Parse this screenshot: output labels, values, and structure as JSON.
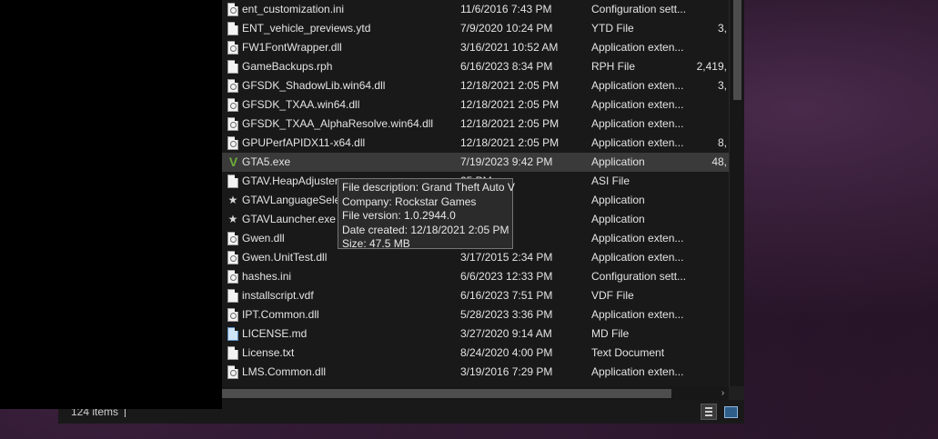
{
  "files": [
    {
      "name": "ent_customization.ini",
      "date": "11/6/2016 7:43 PM",
      "type": "Configuration sett...",
      "size": "",
      "icon": "settings-file-icon"
    },
    {
      "name": "ENT_vehicle_previews.ytd",
      "date": "7/9/2020 10:24 PM",
      "type": "YTD File",
      "size": "3,",
      "icon": "file-icon"
    },
    {
      "name": "FW1FontWrapper.dll",
      "date": "3/16/2021 10:52 AM",
      "type": "Application exten...",
      "size": "",
      "icon": "dll-file-icon"
    },
    {
      "name": "GameBackups.rph",
      "date": "6/16/2023 8:34 PM",
      "type": "RPH File",
      "size": "2,419,",
      "icon": "file-icon"
    },
    {
      "name": "GFSDK_ShadowLib.win64.dll",
      "date": "12/18/2021 2:05 PM",
      "type": "Application exten...",
      "size": "3,",
      "icon": "dll-file-icon"
    },
    {
      "name": "GFSDK_TXAA.win64.dll",
      "date": "12/18/2021 2:05 PM",
      "type": "Application exten...",
      "size": "",
      "icon": "dll-file-icon"
    },
    {
      "name": "GFSDK_TXAA_AlphaResolve.win64.dll",
      "date": "12/18/2021 2:05 PM",
      "type": "Application exten...",
      "size": "",
      "icon": "dll-file-icon"
    },
    {
      "name": "GPUPerfAPIDX11-x64.dll",
      "date": "12/18/2021 2:05 PM",
      "type": "Application exten...",
      "size": "8,",
      "icon": "dll-file-icon"
    },
    {
      "name": "GTA5.exe",
      "date": "7/19/2023 9:42 PM",
      "type": "Application",
      "size": "48,",
      "icon": "gta-v-icon",
      "hovered": true
    },
    {
      "name": "GTAV.HeapAdjuster.",
      "date": "25 PM",
      "type": "ASI File",
      "size": "",
      "icon": "file-icon"
    },
    {
      "name": "GTAVLanguageSelec",
      "date": "28 PM",
      "type": "Application",
      "size": "",
      "icon": "rockstar-icon"
    },
    {
      "name": "GTAVLauncher.exe",
      "date": "36 PM",
      "type": "Application",
      "size": "",
      "icon": "rockstar-icon"
    },
    {
      "name": "Gwen.dll",
      "date": "34 PM",
      "type": "Application exten...",
      "size": "",
      "icon": "dll-file-icon"
    },
    {
      "name": "Gwen.UnitTest.dll",
      "date": "3/17/2015 2:34 PM",
      "type": "Application exten...",
      "size": "",
      "icon": "dll-file-icon"
    },
    {
      "name": "hashes.ini",
      "date": "6/6/2023 12:33 PM",
      "type": "Configuration sett...",
      "size": "",
      "icon": "settings-file-icon"
    },
    {
      "name": "installscript.vdf",
      "date": "6/16/2023 7:51 PM",
      "type": "VDF File",
      "size": "",
      "icon": "file-icon"
    },
    {
      "name": "IPT.Common.dll",
      "date": "5/28/2023 3:36 PM",
      "type": "Application exten...",
      "size": "",
      "icon": "dll-file-icon"
    },
    {
      "name": "LICENSE.md",
      "date": "3/27/2020 9:14 AM",
      "type": "MD File",
      "size": "",
      "icon": "markdown-file-icon"
    },
    {
      "name": "License.txt",
      "date": "8/24/2020 4:00 PM",
      "type": "Text Document",
      "size": "",
      "icon": "text-file-icon"
    },
    {
      "name": "LMS.Common.dll",
      "date": "3/19/2016 7:29 PM",
      "type": "Application exten...",
      "size": "",
      "icon": "dll-file-icon"
    }
  ],
  "tooltip": {
    "description": "File description: Grand Theft Auto V",
    "company": "Company: Rockstar Games",
    "version": "File version: 1.0.2944.0",
    "created": "Date created: 12/18/2021 2:05 PM",
    "size": "Size: 47.5 MB"
  },
  "status": {
    "item_count": "124 items"
  },
  "icons": {
    "gta": "V",
    "rockstar": "★",
    "scroll_right": "›"
  },
  "colors": {
    "background": "#191919",
    "text": "#e4e4e4",
    "hover_row": "#3a3a3a"
  }
}
